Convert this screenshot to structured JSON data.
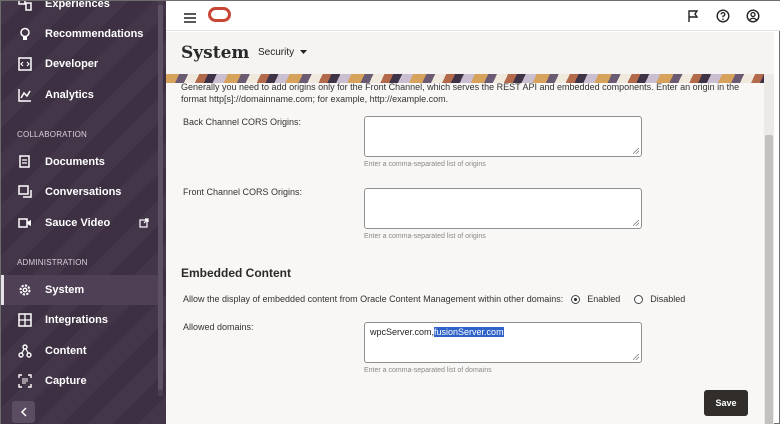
{
  "sidebar": {
    "items": [
      {
        "label": "Experiences"
      },
      {
        "label": "Recommendations"
      },
      {
        "label": "Developer"
      },
      {
        "label": "Analytics"
      },
      {
        "label": "Documents"
      },
      {
        "label": "Conversations"
      },
      {
        "label": "Sauce Video"
      },
      {
        "label": "System"
      },
      {
        "label": "Integrations"
      },
      {
        "label": "Content"
      },
      {
        "label": "Capture"
      }
    ],
    "sections": {
      "collaboration": "COLLABORATION",
      "administration": "ADMINISTRATION"
    },
    "active": "System"
  },
  "header": {
    "icons": [
      "hamburger-icon",
      "oracle-logo",
      "flag-icon",
      "help-icon",
      "user-icon"
    ]
  },
  "page": {
    "title": "System",
    "section_selector": "Security"
  },
  "cors": {
    "intro": "Generally you need to add origins only for the Front Channel, which serves the REST API and embedded components. Enter an origin in the format http[s]://domainname.com; for example, http://example.com.",
    "back_label": "Back Channel CORS Origins:",
    "back_value": "",
    "back_hint": "Enter a comma-separated list of origins",
    "front_label": "Front Channel CORS Origins:",
    "front_value": "",
    "front_hint": "Enter a comma-separated list of origins"
  },
  "embedded": {
    "heading": "Embedded Content",
    "allow_label": "Allow the display of embedded content from Oracle Content Management within other domains:",
    "enabled_label": "Enabled",
    "disabled_label": "Disabled",
    "selected": "Enabled",
    "domains_label": "Allowed domains:",
    "domains_value_plain": "wpcServer.com,",
    "domains_value_selected": "fusionServer.com",
    "domains_hint": "Enter a comma-separated list of domains"
  },
  "actions": {
    "save_label": "Save"
  },
  "colors": {
    "sidebar_bg": "#3e3144",
    "accent": "#c74634",
    "save_bg": "#312d2a"
  }
}
